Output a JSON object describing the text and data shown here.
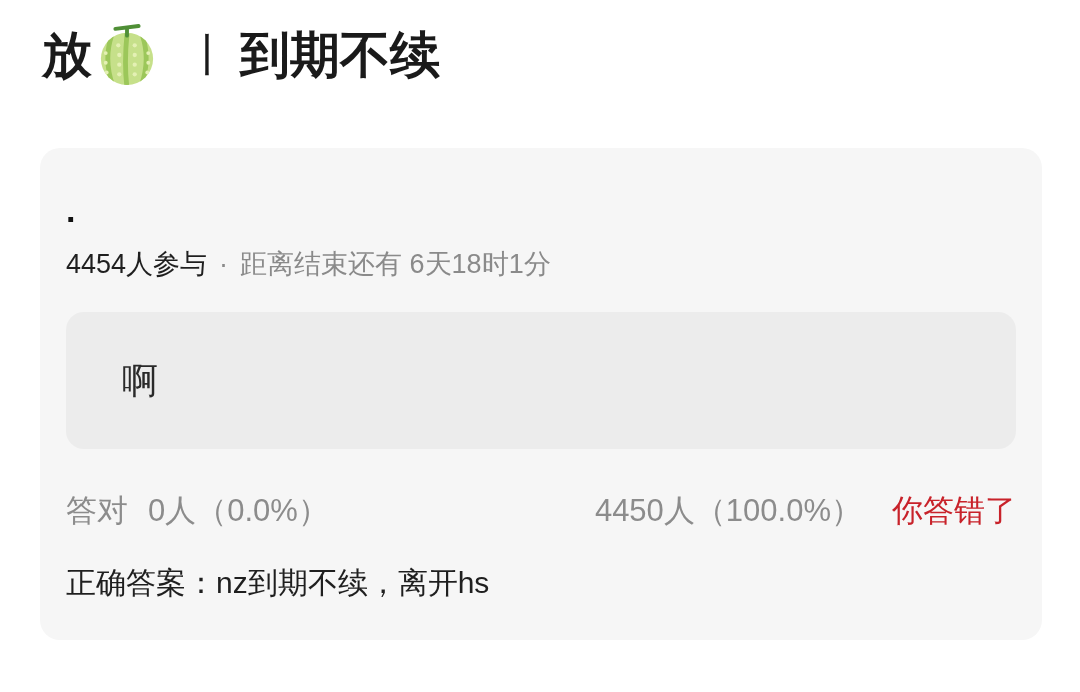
{
  "title": {
    "lead": "放",
    "separator": "丨",
    "text": "到期不续"
  },
  "poll": {
    "question": ".",
    "participants": "4454人参与",
    "separator": "·",
    "countdown": "距离结束还有 6天18时1分",
    "options": [
      {
        "label": "啊"
      }
    ],
    "results": {
      "correct_label": "答对",
      "correct_count": "0人（0.0%）",
      "your_count": "4450人（100.0%）",
      "verdict": {
        "text": "你答错了",
        "correct": false
      }
    },
    "answer": "正确答案：nz到期不续，离开hs"
  }
}
